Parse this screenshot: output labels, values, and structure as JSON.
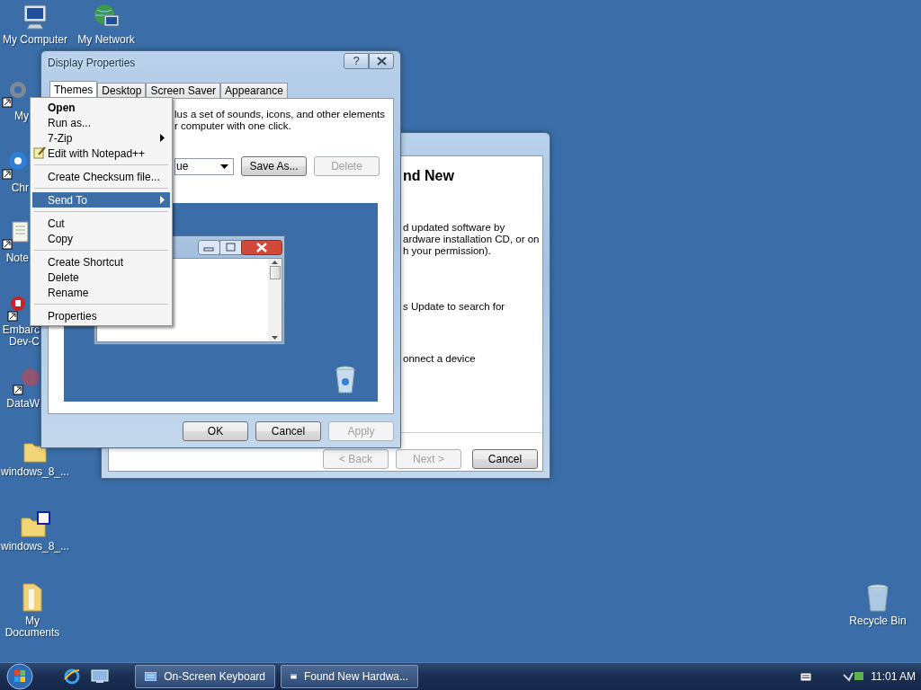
{
  "desktop_icons": [
    {
      "label": "My Computer",
      "kind": "computer"
    },
    {
      "label": "My Network",
      "kind": "network"
    },
    {
      "label": "My",
      "kind": "gear"
    },
    {
      "label": "Chr",
      "kind": "browser"
    },
    {
      "label": "Note",
      "kind": "notepad"
    },
    {
      "label": "Embarc Dev-C",
      "kind": "app"
    },
    {
      "label": "DataW",
      "kind": "database"
    },
    {
      "label": "windows_8_...",
      "kind": "folder"
    },
    {
      "label": "windows_8_...",
      "kind": "tagged"
    },
    {
      "label": "My Documents",
      "kind": "documents"
    },
    {
      "label": "Recycle Bin",
      "kind": "recycle"
    }
  ],
  "hardware_window": {
    "heading": "nd New",
    "paragraphs": [
      "d updated software by\nardware installation CD, or on\nh your permission).",
      "s Update to search for",
      "onnect a device"
    ],
    "buttons": [
      {
        "label": "< Back",
        "disabled": true
      },
      {
        "label": "Next >",
        "disabled": true
      },
      {
        "label": "Cancel",
        "disabled": false
      }
    ]
  },
  "display_window": {
    "title": "Display Properties",
    "help": "?",
    "tabs": [
      {
        "label": "Themes",
        "selected": true
      },
      {
        "label": "Desktop",
        "selected": false
      },
      {
        "label": "Screen Saver",
        "selected": false
      },
      {
        "label": "Appearance",
        "selected": false
      }
    ],
    "description": [
      "lus a set of sounds, icons, and other elements",
      "r computer with one click."
    ],
    "theme_select": "ue",
    "theme_buttons": [
      {
        "label": "Save As...",
        "disabled": false
      },
      {
        "label": "Delete",
        "disabled": true
      }
    ],
    "buttons": [
      {
        "label": "OK",
        "disabled": false
      },
      {
        "label": "Cancel",
        "disabled": false
      },
      {
        "label": "Apply",
        "disabled": true
      }
    ]
  },
  "context_menu": {
    "groups": [
      [
        {
          "label": "Open",
          "default": true,
          "submenu": false,
          "icon": false,
          "selected": false
        },
        {
          "label": "Run as...",
          "default": false,
          "submenu": false,
          "icon": false,
          "selected": false
        },
        {
          "label": "7-Zip",
          "default": false,
          "submenu": true,
          "icon": false,
          "selected": false
        },
        {
          "label": "Edit with Notepad++",
          "default": false,
          "submenu": false,
          "icon": true,
          "selected": false
        }
      ],
      [
        {
          "label": "Create Checksum file...",
          "default": false,
          "submenu": false,
          "icon": false,
          "selected": false
        }
      ],
      [
        {
          "label": "Send To",
          "default": false,
          "submenu": true,
          "icon": false,
          "selected": true
        }
      ],
      [
        {
          "label": "Cut",
          "default": false,
          "submenu": false,
          "icon": false,
          "selected": false
        },
        {
          "label": "Copy",
          "default": false,
          "submenu": false,
          "icon": false,
          "selected": false
        }
      ],
      [
        {
          "label": "Create Shortcut",
          "default": false,
          "submenu": false,
          "icon": false,
          "selected": false
        },
        {
          "label": "Delete",
          "default": false,
          "submenu": false,
          "icon": false,
          "selected": false
        },
        {
          "label": "Rename",
          "default": false,
          "submenu": false,
          "icon": false,
          "selected": false
        }
      ],
      [
        {
          "label": "Properties",
          "default": false,
          "submenu": false,
          "icon": false,
          "selected": false
        }
      ]
    ]
  },
  "taskbar": {
    "tasks": [
      {
        "label": "On-Screen Keyboard",
        "kind": "keyboard"
      },
      {
        "label": "Found New Hardwa...",
        "kind": "window"
      }
    ],
    "clock": "11:01 AM"
  }
}
